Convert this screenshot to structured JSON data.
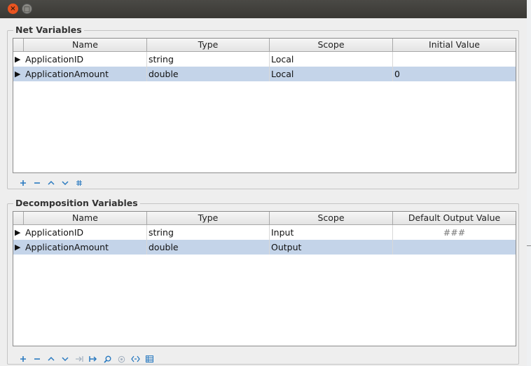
{
  "window": {
    "close_glyph": "×",
    "max_glyph": "□"
  },
  "net_variables": {
    "title": "Net Variables",
    "columns": [
      "Name",
      "Type",
      "Scope",
      "Initial Value"
    ],
    "rows": [
      {
        "marker": "▶",
        "name": "ApplicationID",
        "type": "string",
        "scope": "Local",
        "value": ""
      },
      {
        "marker": "▶",
        "name": "ApplicationAmount",
        "type": "double",
        "scope": "Local",
        "value": "0"
      }
    ],
    "toolbar": [
      "add-icon",
      "remove-icon",
      "move-up-icon",
      "move-down-icon",
      "hash-icon"
    ]
  },
  "decomposition_variables": {
    "title": "Decomposition Variables",
    "columns": [
      "Name",
      "Type",
      "Scope",
      "Default Output Value"
    ],
    "rows": [
      {
        "marker": "▶",
        "name": "ApplicationID",
        "type": "string",
        "scope": "Input",
        "value": "###"
      },
      {
        "marker": "▶",
        "name": "ApplicationAmount",
        "type": "double",
        "scope": "Output",
        "value": ""
      }
    ],
    "toolbar": [
      "add-icon",
      "remove-icon",
      "move-up-icon",
      "move-down-icon",
      "map-to-net-icon",
      "map-from-net-icon",
      "search-icon",
      "target-icon",
      "code-icon",
      "table-icon"
    ]
  },
  "colors": {
    "selection": "#c4d4e9",
    "icon_blue": "#2a7ac0",
    "close_button": "#e95420"
  }
}
